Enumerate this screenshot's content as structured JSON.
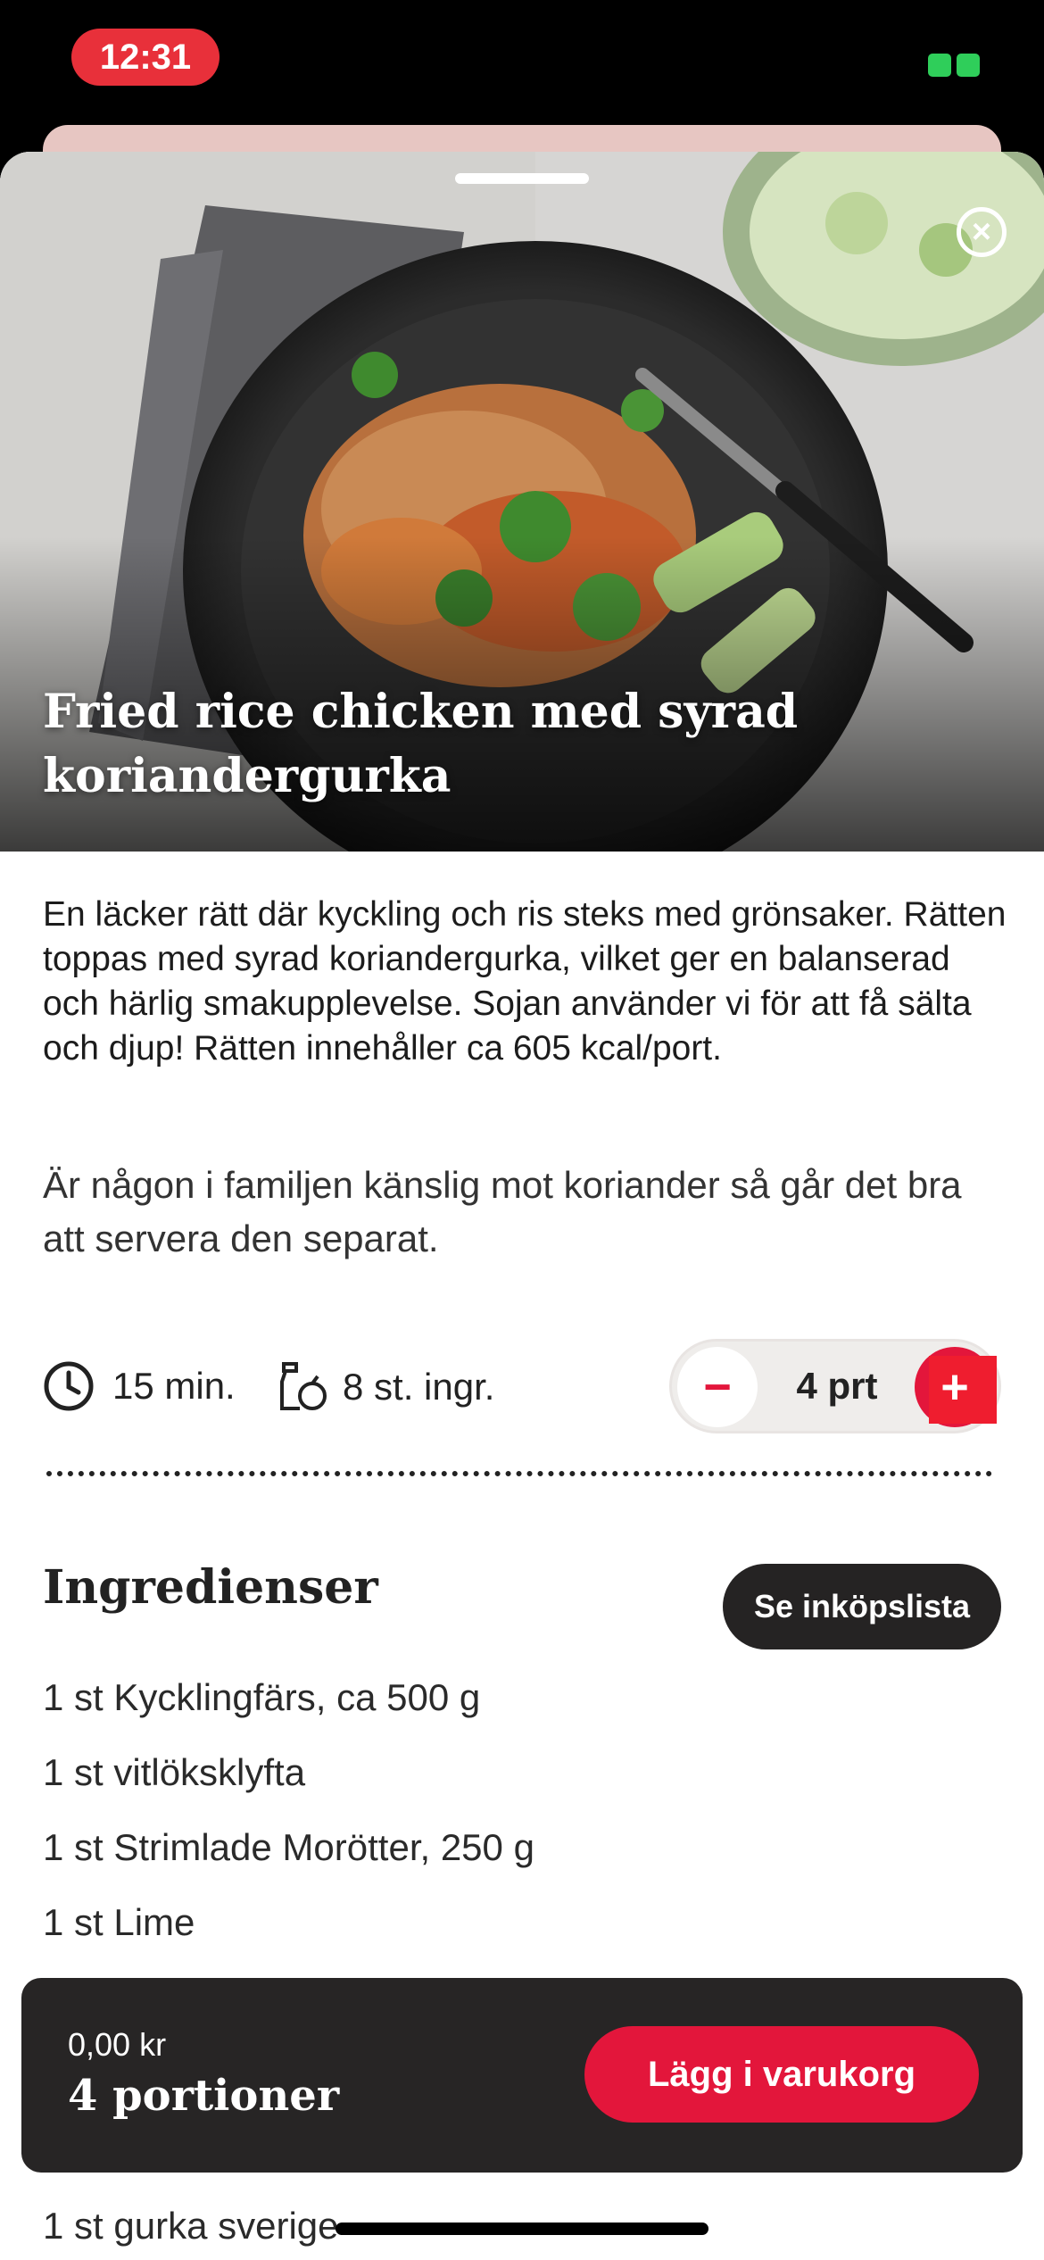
{
  "status_bar": {
    "time": "12:31"
  },
  "recipe": {
    "title": "Fried rice chicken med syrad koriandergurka",
    "description": "En läcker rätt där kyckling och ris steks med grönsaker. Rätten toppas med syrad koriandergurka, vilket ger en balanserad och härlig smakupplevelse. Sojan använder vi för att få sälta och djup! Rätten innehåller ca 605 kcal/port.",
    "note": "Är någon i familjen känslig mot koriander så går det bra att servera den separat.",
    "time": "15 min.",
    "ingredient_count": "8 st. ingr.",
    "portions_label": "4 prt"
  },
  "icons": {
    "close": "close-icon",
    "clock": "clock-icon",
    "ingredients": "bottle-icon",
    "minus": "minus-icon",
    "plus": "plus-icon"
  },
  "stepper": {
    "minus": "−",
    "plus": "+"
  },
  "ingredients": {
    "heading": "Ingredienser",
    "shopping_list_button": "Se inköpslista",
    "items": [
      "1 st Kycklingfärs, ca 500 g",
      "1 st vitlöksklyfta",
      "1 st Strimlade Morötter, 250 g",
      "1 st Lime"
    ],
    "partially_visible": "1 st gurka sverige"
  },
  "cart": {
    "price": "0,00 kr",
    "portions": "4 portioner",
    "button": "Lägg i varukorg"
  },
  "colors": {
    "accent": "#e3163b",
    "dark_panel": "#272525",
    "time_pill": "#e8303a"
  }
}
